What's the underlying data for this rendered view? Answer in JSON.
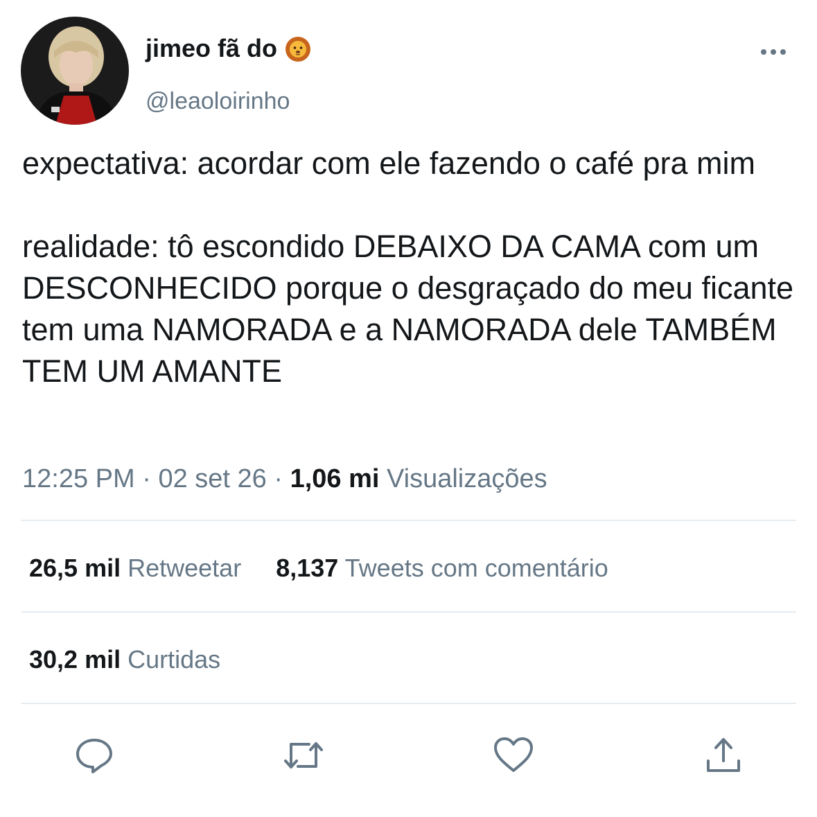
{
  "user": {
    "display_name": "jimeo fã do",
    "emoji_icon": "lion-face-icon",
    "handle": "@leaoloirinho"
  },
  "tweet": {
    "paragraphs": [
      "expectativa: acordar com ele fazendo o café pra mim",
      "realidade: tô escondido DEBAIXO DA CAMA com um DESCONHECIDO porque o desgraçado do meu ficante tem uma NAMORADA e a NAMORADA dele TAMBÉM TEM UM AMANTE"
    ]
  },
  "meta": {
    "time": "12:25 PM",
    "separator": "·",
    "date": "02 set 26",
    "views_count": "1,06 mi",
    "views_label": "Visualizações"
  },
  "stats": {
    "retweets_count": "26,5 mil",
    "retweets_label": "Retweetar",
    "quotes_count": "8,137",
    "quotes_label": "Tweets com comentário",
    "likes_count": "30,2 mil",
    "likes_label": "Curtidas"
  },
  "actions": [
    {
      "icon": "reply-icon"
    },
    {
      "icon": "retweet-icon"
    },
    {
      "icon": "like-heart-icon"
    },
    {
      "icon": "share-icon"
    }
  ],
  "colors": {
    "text_primary": "#14171a",
    "text_secondary": "#657786",
    "divider": "#e6ecf0",
    "icon": "#657786"
  }
}
